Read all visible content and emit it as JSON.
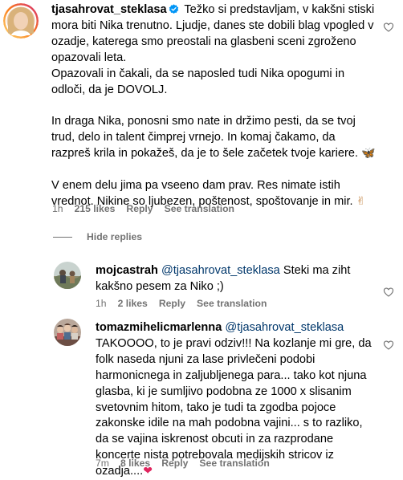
{
  "comment": {
    "username": "tjasahrovat_steklasa",
    "verified": true,
    "paragraphs": [
      "Težko si predstavljam, v kakšni stiski mora biti Nika trenutno. Ljudje, danes ste dobili blag vpogled v ozadje, katerega smo preostali na glasbeni sceni zgroženo opazovali leta.",
      "Opazovali in čakali, da se naposled tudi Nika opogumi in odloči, da je DOVOLJ.",
      "In draga Nika, ponosni smo nate in držimo pesti, da se tvoj trud, delo in talent čimprej vrnejo. In komaj čakamo, da razpreš krila in pokažeš, da je to šele začetek tvoje kariere.",
      "V enem delu jima pa vseeno dam prav. Res nimate istih vrednot. Nikine so ljubezen, poštenost, spoštovanje in mir."
    ],
    "emoji_butterfly": "🦋",
    "emoji_hand": "✌",
    "time": "1h",
    "likes": "215 likes",
    "reply_label": "Reply",
    "translate_label": "See translation"
  },
  "hide_replies_label": "Hide replies",
  "replies": [
    {
      "username": "mojcastrah",
      "mention": "@tjasahrovat_steklasa",
      "text": "Steki ma ziht kakšno pesem za Niko ;)",
      "time": "1h",
      "likes": "2 likes",
      "reply_label": "Reply",
      "translate_label": "See translation"
    },
    {
      "username": "tomazmihelicmarlenna",
      "mention": "@tjasahrovat_steklasa",
      "text": "TAKOOOO, to je pravi odziv!!! Na kozlanje mi gre, da folk naseda njuni za lase privlečeni podobi harmonicnega in zaljubljenega para... tako kot njuna glasba, ki je sumljivo podobna ze 1000 x slisanim svetovnim hitom, tako je tudi ta zgodba pojoce zakonske idile na mah podobna vajini... s to razliko, da se vajina iskrenost obcuti in za razprodane koncerte nista potrebovala medijskih stricov iz ozadja....",
      "emoji_heart": "❤",
      "time": "7m",
      "likes": "8 likes",
      "reply_label": "Reply",
      "translate_label": "See translation"
    }
  ],
  "colors": {
    "secondary_text": "#737373",
    "mention": "#00376b",
    "verified_badge": "#0095f6",
    "heart": "#e0245e",
    "butterfly": "#e07a1f"
  },
  "icons": {
    "verified": "verified-badge-icon",
    "like": "heart-outline-icon"
  }
}
